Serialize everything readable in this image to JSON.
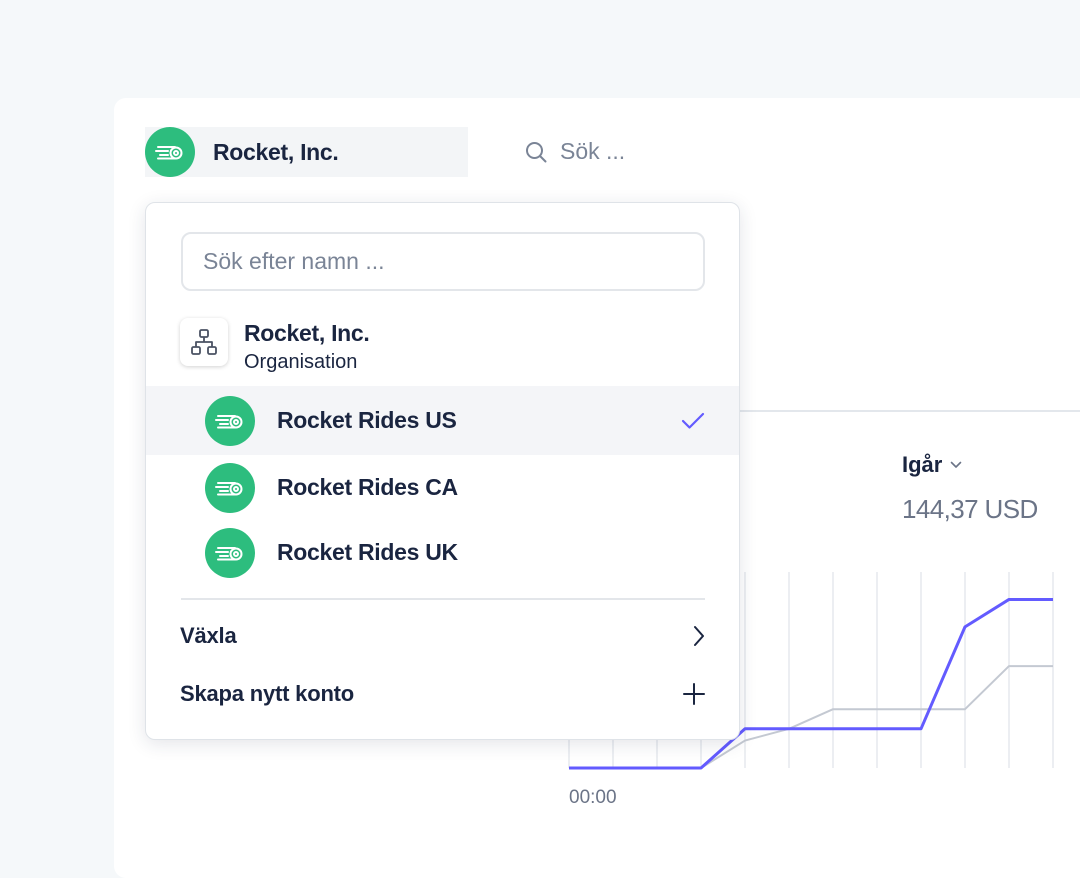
{
  "header": {
    "account_name": "Rocket, Inc.",
    "search_placeholder": "Sök ..."
  },
  "dropdown": {
    "search_placeholder": "Sök efter namn ...",
    "organization": {
      "name": "Rocket, Inc.",
      "type": "Organisation"
    },
    "accounts": [
      {
        "label": "Rocket Rides US",
        "selected": true
      },
      {
        "label": "Rocket Rides CA",
        "selected": false
      },
      {
        "label": "Rocket Rides UK",
        "selected": false
      }
    ],
    "actions": {
      "switch_label": "Växla",
      "create_label": "Skapa nytt konto"
    }
  },
  "metrics": {
    "period_label": "Igår",
    "period_value": "144,37 USD"
  },
  "chart_data": {
    "type": "line",
    "x": [
      "00:00",
      "",
      "",
      "",
      "",
      "",
      "",
      "",
      "",
      "",
      "",
      ""
    ],
    "series": [
      {
        "values": [
          0,
          0,
          0,
          0,
          1,
          1,
          1,
          1,
          1,
          3.6,
          4.3,
          4.3
        ]
      },
      {
        "values": [
          0,
          0,
          0,
          0,
          0.7,
          1,
          1.5,
          1.5,
          1.5,
          1.5,
          2.6,
          2.6
        ]
      }
    ],
    "colors": [
      "#635bff",
      "#c4c9d2"
    ],
    "grid": true,
    "xlabel": "00:00"
  },
  "colors": {
    "brand_green": "#2dbd7e",
    "accent": "#635bff"
  }
}
